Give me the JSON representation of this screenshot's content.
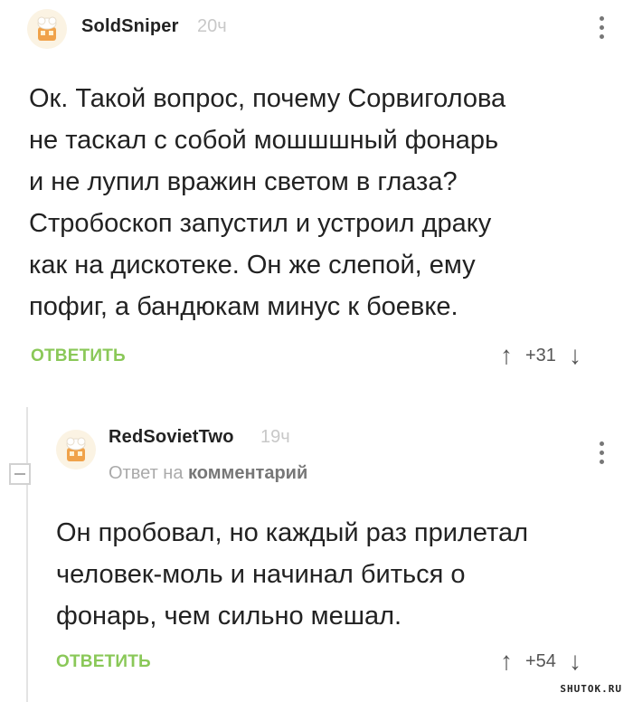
{
  "comments": [
    {
      "author": "SoldSniper",
      "time": "20ч",
      "text_lines": [
        "Ок. Такой вопрос, почему Сорвиголова",
        "не таскал с собой мошшшный фонарь",
        "и не лупил вражин светом в глаза?",
        "Стробоскоп запустил и устроил драку",
        "как на дискотеке. Он же слепой, ему",
        "пофиг, а бандюкам минус к боевке."
      ],
      "reply_label": "ОТВЕТИТЬ",
      "score": "+31"
    },
    {
      "author": "RedSovietTwo",
      "time": "19ч",
      "reply_to_prefix": "Ответ на",
      "reply_to_target": "комментарий",
      "text_lines": [
        "Он пробовал, но каждый раз прилетал",
        "человек-моль и начинал биться о",
        "фонарь, чем сильно мешал."
      ],
      "reply_label": "ОТВЕТИТЬ",
      "score": "+54"
    }
  ],
  "icons": {
    "upvote": "↑",
    "downvote": "↓"
  },
  "colors": {
    "reply_green": "#8ac858",
    "time_gray": "#c8c8c8"
  },
  "watermark": "SHUTOK.RU"
}
